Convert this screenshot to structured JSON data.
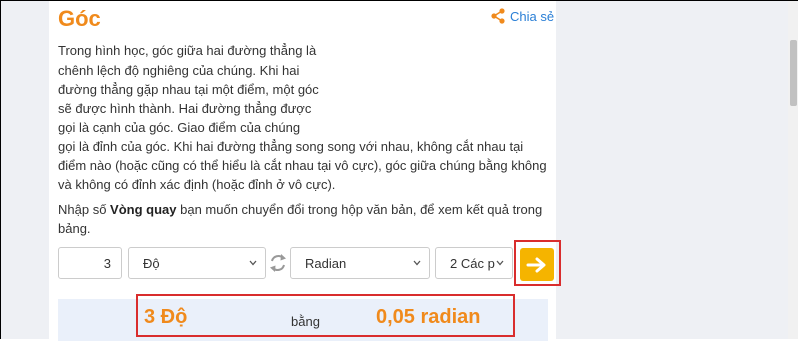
{
  "header": {
    "title": "Góc",
    "share_label": "Chia sẻ"
  },
  "description_lines": [
    "Trong hình học, góc giữa hai đường thẳng là",
    "chênh lệch độ nghiêng của chúng. Khi hai",
    "đường thẳng gặp nhau tại một điểm, một góc",
    "sẽ được hình thành. Hai đường thẳng được",
    "gọi là cạnh của góc. Giao điểm của chúng",
    "gọi là đỉnh của góc. Khi hai đường thẳng song song với nhau, không cắt nhau tại",
    "điểm nào (hoặc cũng có thể hiểu là cắt nhau tại vô cực), góc giữa chúng bằng không",
    "và không có đỉnh xác định (hoặc đỉnh ở vô cực)."
  ],
  "instruction": {
    "prefix": "Nhập số ",
    "bold": "Vòng quay",
    "suffix": " bạn muốn chuyển đổi trong hộp văn bản, để xem kết quả trong bảng."
  },
  "converter": {
    "value": "3",
    "from_unit": "Độ",
    "to_unit": "Radian",
    "precision": "2 Các p"
  },
  "result": {
    "left": "3 Độ",
    "middle": "bằng",
    "right": "0,05 radian"
  },
  "colors": {
    "accent": "#f08a1c",
    "button": "#f5b400",
    "highlight": "#d92d2d",
    "link": "#2a7fd6"
  }
}
